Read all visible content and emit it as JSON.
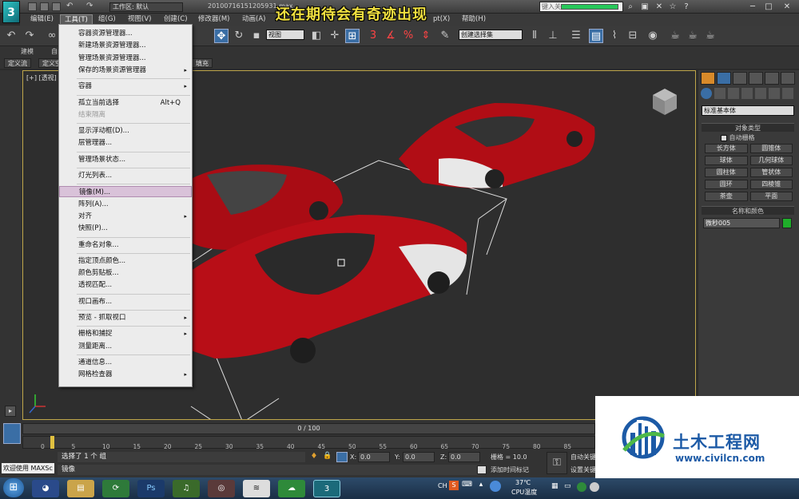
{
  "overlay_title": "还在期待会有奇迹出现",
  "titlebar": {
    "workspace": "工作区: 默认",
    "filename": "20100716151205931.max",
    "search_placeholder": "键入关"
  },
  "menubar": [
    "编辑(E)",
    "工具(T)",
    "组(G)",
    "视图(V)",
    "创建(C)",
    "修改器(M)",
    "动画(A)",
    "pt(X)",
    "帮助(H)"
  ],
  "toolbar": {
    "view_select": "视图",
    "selection_set": "创建选择集",
    "snap_labels": [
      "3",
      "%",
      "n"
    ]
  },
  "ribbon": {
    "tabs": [
      "建模",
      "自由"
    ],
    "subtabs": [
      "定义流",
      "定义空间",
      "填充"
    ]
  },
  "viewport": {
    "label": "[+] [透视]"
  },
  "tools_menu": {
    "items": [
      {
        "label": "容器资源管理器...",
        "enabled": true
      },
      {
        "label": "新建场景资源管理器...",
        "enabled": true
      },
      {
        "label": "管理场景资源管理器...",
        "enabled": true
      },
      {
        "label": "保存的场景资源管理器",
        "enabled": true,
        "submenu": true
      },
      {
        "sep": true
      },
      {
        "label": "容器",
        "enabled": true,
        "submenu": true
      },
      {
        "sep": true
      },
      {
        "label": "孤立当前选择",
        "enabled": true,
        "shortcut": "Alt+Q"
      },
      {
        "label": "结束隔离",
        "enabled": false
      },
      {
        "sep": true
      },
      {
        "label": "显示浮动框(D)...",
        "enabled": true
      },
      {
        "label": "层管理器...",
        "enabled": true
      },
      {
        "sep": true
      },
      {
        "label": "管理场景状态...",
        "enabled": true
      },
      {
        "sep": true
      },
      {
        "label": "灯光列表...",
        "enabled": true
      },
      {
        "sep": true
      },
      {
        "label": "镜像(M)...",
        "enabled": true,
        "highlighted": true
      },
      {
        "label": "阵列(A)...",
        "enabled": true
      },
      {
        "label": "对齐",
        "enabled": true,
        "submenu": true
      },
      {
        "label": "快照(P)...",
        "enabled": true
      },
      {
        "sep": true
      },
      {
        "label": "重命名对象...",
        "enabled": true
      },
      {
        "sep": true
      },
      {
        "label": "指定顶点颜色...",
        "enabled": true
      },
      {
        "label": "颜色剪贴板...",
        "enabled": true
      },
      {
        "label": "透视匹配...",
        "enabled": true
      },
      {
        "sep": true
      },
      {
        "label": "视口画布...",
        "enabled": true
      },
      {
        "sep": true
      },
      {
        "label": "预览 - 抓取视口",
        "enabled": true,
        "submenu": true
      },
      {
        "sep": true
      },
      {
        "label": "栅格和捕捉",
        "enabled": true,
        "submenu": true
      },
      {
        "label": "测量距离...",
        "enabled": true
      },
      {
        "sep": true
      },
      {
        "label": "通道信息...",
        "enabled": true
      },
      {
        "label": "网格检查器",
        "enabled": true,
        "submenu": true
      }
    ]
  },
  "command_panel": {
    "category": "标准基本体",
    "object_type_header": "对象类型",
    "autogrid": "自动栅格",
    "buttons": [
      "长方体",
      "圆锥体",
      "球体",
      "几何球体",
      "圆柱体",
      "管状体",
      "圆环",
      "四棱锥",
      "茶壶",
      "平面"
    ],
    "name_color_header": "名称和颜色",
    "object_name": "微秒005",
    "object_color": "#1fae2a"
  },
  "timeline": {
    "frame": "0 / 100",
    "ticks": [
      "0",
      "5",
      "10",
      "15",
      "20",
      "25",
      "30",
      "35",
      "40",
      "45",
      "50",
      "55",
      "60",
      "65",
      "70",
      "75",
      "80",
      "85"
    ]
  },
  "status": {
    "welcome": "欢迎使用 MAXSc",
    "selection": "选择了 1 个 组",
    "prompt": "镜像",
    "x_label": "X:",
    "x_value": "0.0",
    "y_label": "Y:",
    "y_value": "0.0",
    "z_label": "Z:",
    "z_value": "0.0",
    "grid": "栅格 = 10.0",
    "add_time_tag": "添加时间标记",
    "auto_key": "自动关键",
    "set_key": "设置关键"
  },
  "taskbar": {
    "temperature": "37℃",
    "cpu_label": "CPU温度",
    "ime": "CH"
  },
  "watermark": {
    "name": "土木工程网",
    "url": "www.civilcn.com"
  }
}
